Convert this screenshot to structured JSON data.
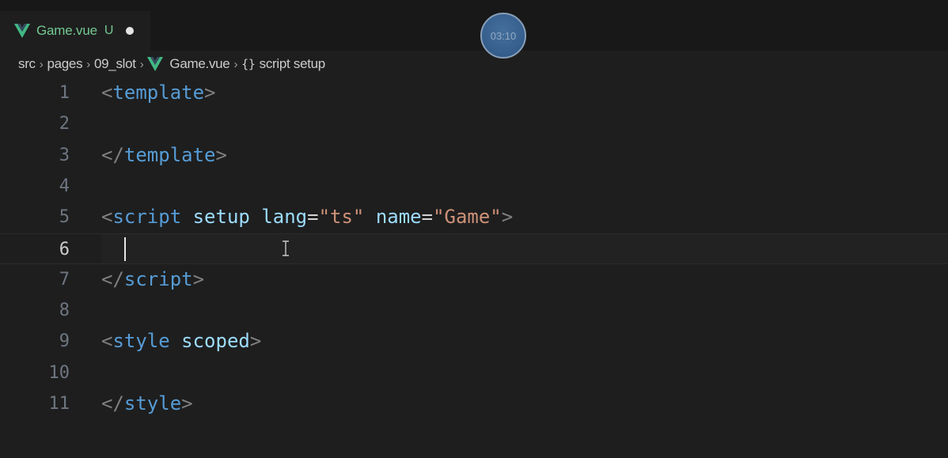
{
  "tab": {
    "filename": "Game.vue",
    "status": "U",
    "icon": "vue-logo-icon",
    "color": "#73c991"
  },
  "timer": {
    "label": "03:10"
  },
  "breadcrumb": {
    "items": [
      "src",
      "pages",
      "09_slot"
    ],
    "file": "Game.vue",
    "symbol_icon": "{}",
    "symbol": "script setup"
  },
  "editor": {
    "current_line": 6,
    "lines": [
      {
        "n": "1",
        "tokens": [
          {
            "t": "<",
            "c": "punct"
          },
          {
            "t": "template",
            "c": "tag"
          },
          {
            "t": ">",
            "c": "punct"
          }
        ]
      },
      {
        "n": "2",
        "tokens": []
      },
      {
        "n": "3",
        "tokens": [
          {
            "t": "</",
            "c": "punct"
          },
          {
            "t": "template",
            "c": "tag"
          },
          {
            "t": ">",
            "c": "punct"
          }
        ]
      },
      {
        "n": "4",
        "tokens": []
      },
      {
        "n": "5",
        "tokens": [
          {
            "t": "<",
            "c": "punct"
          },
          {
            "t": "script",
            "c": "tag"
          },
          {
            "t": " ",
            "c": "eq"
          },
          {
            "t": "setup",
            "c": "attr"
          },
          {
            "t": " ",
            "c": "eq"
          },
          {
            "t": "lang",
            "c": "attr"
          },
          {
            "t": "=",
            "c": "eq"
          },
          {
            "t": "\"ts\"",
            "c": "str"
          },
          {
            "t": " ",
            "c": "eq"
          },
          {
            "t": "name",
            "c": "attr"
          },
          {
            "t": "=",
            "c": "eq"
          },
          {
            "t": "\"Game\"",
            "c": "str"
          },
          {
            "t": ">",
            "c": "punct"
          }
        ]
      },
      {
        "n": "6",
        "tokens": []
      },
      {
        "n": "7",
        "tokens": [
          {
            "t": "</",
            "c": "punct"
          },
          {
            "t": "script",
            "c": "tag"
          },
          {
            "t": ">",
            "c": "punct"
          }
        ]
      },
      {
        "n": "8",
        "tokens": []
      },
      {
        "n": "9",
        "tokens": [
          {
            "t": "<",
            "c": "punct"
          },
          {
            "t": "style",
            "c": "tag"
          },
          {
            "t": " ",
            "c": "eq"
          },
          {
            "t": "scoped",
            "c": "attr"
          },
          {
            "t": ">",
            "c": "punct"
          }
        ]
      },
      {
        "n": "10",
        "tokens": []
      },
      {
        "n": "11",
        "tokens": [
          {
            "t": "</",
            "c": "punct"
          },
          {
            "t": "style",
            "c": "tag"
          },
          {
            "t": ">",
            "c": "punct"
          }
        ]
      }
    ]
  },
  "colors": {
    "background": "#1e1e1e",
    "tag": "#569cd6",
    "attribute": "#9cdcfe",
    "string": "#ce9178",
    "punctuation": "#808080",
    "line_number": "#6e7681"
  }
}
